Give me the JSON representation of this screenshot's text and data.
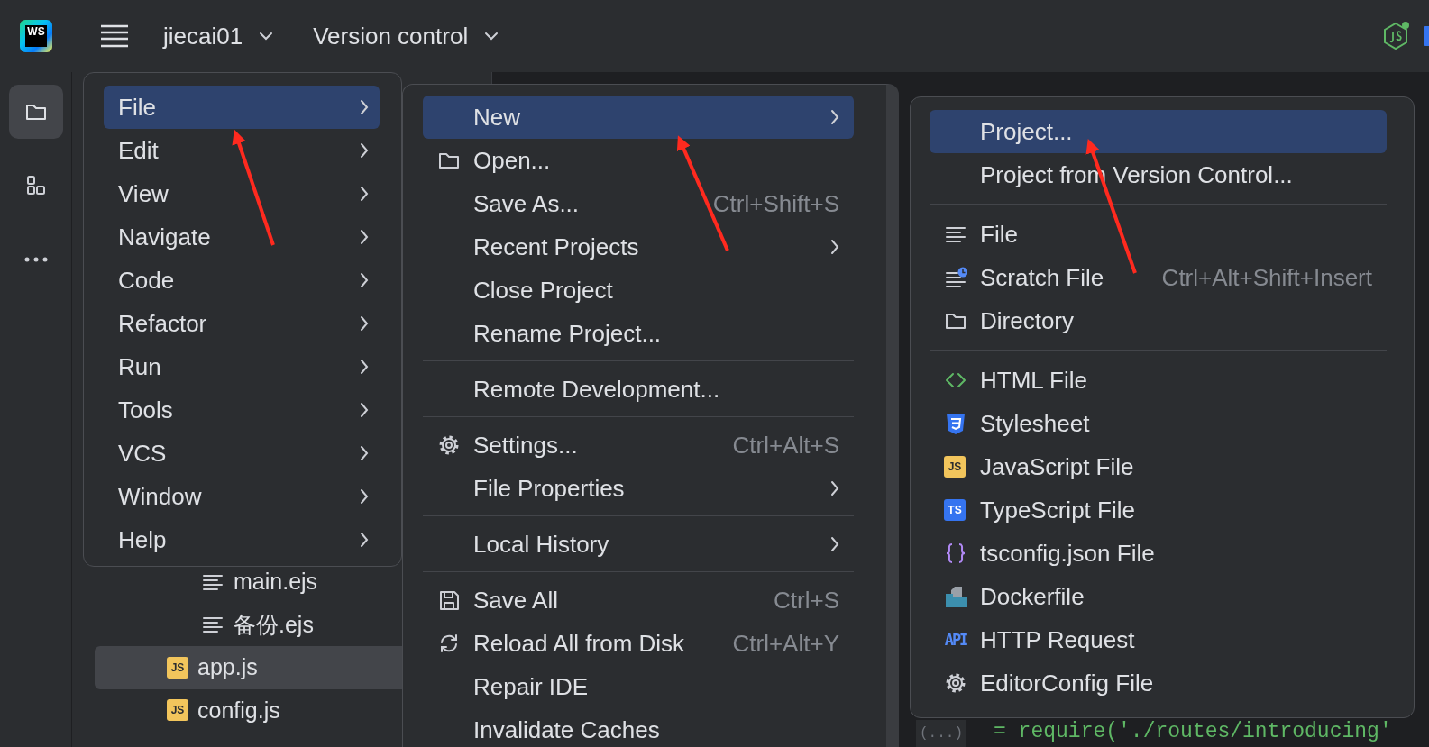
{
  "top_bar": {
    "logo_badge": "WS",
    "project": "jiecai01",
    "vcs": "Version control"
  },
  "tool_window_bar": {
    "items": [
      {
        "selected": true
      },
      {
        "selected": false
      },
      {
        "selected": false
      }
    ]
  },
  "project_tree": {
    "items": [
      {
        "kind": "group",
        "children": [
          {
            "kind": "text",
            "label": "main.ejs",
            "selected": false
          },
          {
            "kind": "text",
            "label": "备份.ejs",
            "selected": false
          }
        ]
      },
      {
        "kind": "script",
        "label": "app.js",
        "badge": "JS",
        "selected": true
      },
      {
        "kind": "script",
        "label": "config.js",
        "badge": "JS",
        "selected": false
      }
    ]
  },
  "editor": {
    "fold_marker": "(...)",
    "code": "= require('./routes/introducing'"
  },
  "menus": [
    {
      "items": [
        {
          "kind": "plain",
          "label": "File",
          "submenu": true,
          "selected": true
        },
        {
          "kind": "plain",
          "label": "Edit",
          "submenu": true,
          "selected": false
        },
        {
          "kind": "plain",
          "label": "View",
          "submenu": true,
          "selected": false
        },
        {
          "kind": "plain",
          "label": "Navigate",
          "submenu": true,
          "selected": false
        },
        {
          "kind": "plain",
          "label": "Code",
          "submenu": true,
          "selected": false
        },
        {
          "kind": "plain",
          "label": "Refactor",
          "submenu": true,
          "selected": false
        },
        {
          "kind": "plain",
          "label": "Run",
          "submenu": true,
          "selected": false
        },
        {
          "kind": "plain",
          "label": "Tools",
          "submenu": true,
          "selected": false
        },
        {
          "kind": "plain",
          "label": "VCS",
          "submenu": true,
          "selected": false
        },
        {
          "kind": "plain",
          "label": "Window",
          "submenu": true,
          "selected": false
        },
        {
          "kind": "plain",
          "label": "Help",
          "submenu": true,
          "selected": false
        }
      ]
    },
    {
      "items": [
        {
          "kind": "plain",
          "label": "New",
          "submenu": true,
          "selected": true
        },
        {
          "kind": "folder",
          "label": "Open...",
          "submenu": false,
          "selected": false
        },
        {
          "kind": "plain",
          "label": "Save As...",
          "shortcut": "Ctrl+Shift+S",
          "submenu": false,
          "selected": false
        },
        {
          "kind": "plain",
          "label": "Recent Projects",
          "submenu": true,
          "selected": false
        },
        {
          "kind": "plain",
          "label": "Close Project",
          "submenu": false,
          "selected": false
        },
        {
          "kind": "plain",
          "label": "Rename Project...",
          "submenu": false,
          "selected": false
        },
        {
          "kind": "separator"
        },
        {
          "kind": "plain",
          "label": "Remote Development...",
          "submenu": false,
          "selected": false
        },
        {
          "kind": "separator"
        },
        {
          "kind": "settings",
          "label": "Settings...",
          "shortcut": "Ctrl+Alt+S",
          "submenu": false,
          "selected": false
        },
        {
          "kind": "plain",
          "label": "File Properties",
          "submenu": true,
          "selected": false
        },
        {
          "kind": "separator"
        },
        {
          "kind": "plain",
          "label": "Local History",
          "submenu": true,
          "selected": false
        },
        {
          "kind": "separator"
        },
        {
          "kind": "save",
          "label": "Save All",
          "shortcut": "Ctrl+S",
          "submenu": false,
          "selected": false
        },
        {
          "kind": "reload",
          "label": "Reload All from Disk",
          "shortcut": "Ctrl+Alt+Y",
          "submenu": false,
          "selected": false
        },
        {
          "kind": "plain",
          "label": "Repair IDE",
          "submenu": false,
          "selected": false
        },
        {
          "kind": "plain",
          "label": "Invalidate Caches",
          "submenu": false,
          "selected": false
        }
      ]
    },
    {
      "items": [
        {
          "kind": "plain",
          "label": "Project...",
          "submenu": false,
          "selected": true
        },
        {
          "kind": "plain",
          "label": "Project from Version Control...",
          "submenu": false,
          "selected": false
        },
        {
          "kind": "separator"
        },
        {
          "kind": "text",
          "label": "File",
          "submenu": false,
          "selected": false
        },
        {
          "kind": "scratch",
          "label": "Scratch File",
          "shortcut": "Ctrl+Alt+Shift+Insert",
          "submenu": false,
          "selected": false
        },
        {
          "kind": "folder",
          "label": "Directory",
          "submenu": false,
          "selected": false
        },
        {
          "kind": "separator"
        },
        {
          "kind": "html",
          "label": "HTML File",
          "submenu": false,
          "selected": false
        },
        {
          "kind": "css",
          "label": "Stylesheet",
          "submenu": false,
          "selected": false
        },
        {
          "kind": "script",
          "label": "JavaScript File",
          "badge": "JS",
          "submenu": false,
          "selected": false
        },
        {
          "kind": "typescript",
          "label": "TypeScript File",
          "badge": "TS",
          "submenu": false,
          "selected": false
        },
        {
          "kind": "json",
          "label": "tsconfig.json File",
          "submenu": false,
          "selected": false
        },
        {
          "kind": "docker",
          "label": "Dockerfile",
          "submenu": false,
          "selected": false
        },
        {
          "kind": "http",
          "label": "HTTP Request",
          "badge": "API",
          "submenu": false,
          "selected": false
        },
        {
          "kind": "settings",
          "label": "EditorConfig File",
          "submenu": false,
          "selected": false
        }
      ]
    }
  ]
}
